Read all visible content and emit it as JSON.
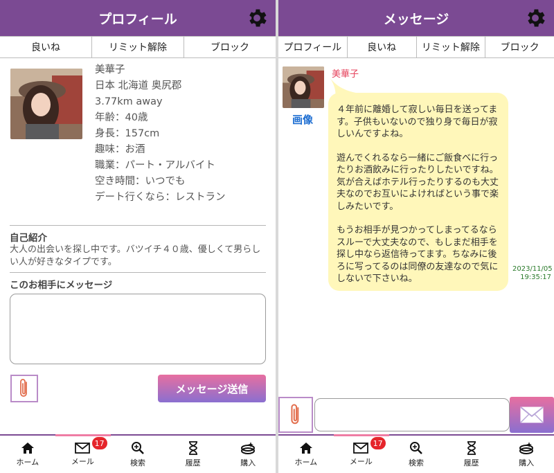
{
  "profile_screen": {
    "title": "プロフィール",
    "tabs": [
      "良いね",
      "リミット解除",
      "ブロック"
    ],
    "name": "美華子",
    "location": "日本 北海道 奥尻郡",
    "distance": "3.77km away",
    "age": "年齢：40歳",
    "height": "身長：157cm",
    "hobby": "趣味：お酒",
    "job": "職業：パート・アルバイト",
    "free_time": "空き時間：いつでも",
    "date_place": "デート行くなら：レストラン",
    "intro_title": "自己紹介",
    "intro_text": "大人の出会いを探し中です。バツイチ４０歳、優しくて男らしい人が好きなタイプです。",
    "message_title": "このお相手にメッセージ",
    "send_label": "メッセージ送信"
  },
  "message_screen": {
    "title": "メッセージ",
    "tabs": [
      "プロフィール",
      "良いね",
      "リミット解除",
      "ブロック"
    ],
    "sender": "美華子",
    "image_link": "画像",
    "paragraphs": [
      "４年前に離婚して寂しい毎日を送ってます。子供もいないので独り身で毎日が寂しいんですよね。",
      "遊んでくれるなら一緒にご飯食べに行ったりお酒飲みに行ったりしたいですね。気が合えばホテル行ったりするのも大丈夫なのでお互いによければという事で楽しみたいです。",
      "もうお相手が見つかってしまってるならスルーで大丈夫なので、もしまだ相手を探し中なら返信待ってます。ちなみに後ろに写ってるのは同僚の友達なので気にしないで下さいね。"
    ],
    "date": "2023/11/05",
    "time": "19:35:17"
  },
  "nav": {
    "items": [
      "ホーム",
      "メール",
      "検索",
      "履歴",
      "購入"
    ],
    "mail_badge": "17"
  },
  "icons": [
    "gear-icon",
    "paperclip-icon",
    "home-icon",
    "mail-icon",
    "search-icon",
    "hourglass-icon",
    "purchase-icon",
    "envelope-icon"
  ],
  "colors": {
    "header": "#7b4a93",
    "bubble": "#fff7ba",
    "badge": "#e5252b",
    "sender": "#e6435c",
    "link": "#1f6fd2"
  }
}
